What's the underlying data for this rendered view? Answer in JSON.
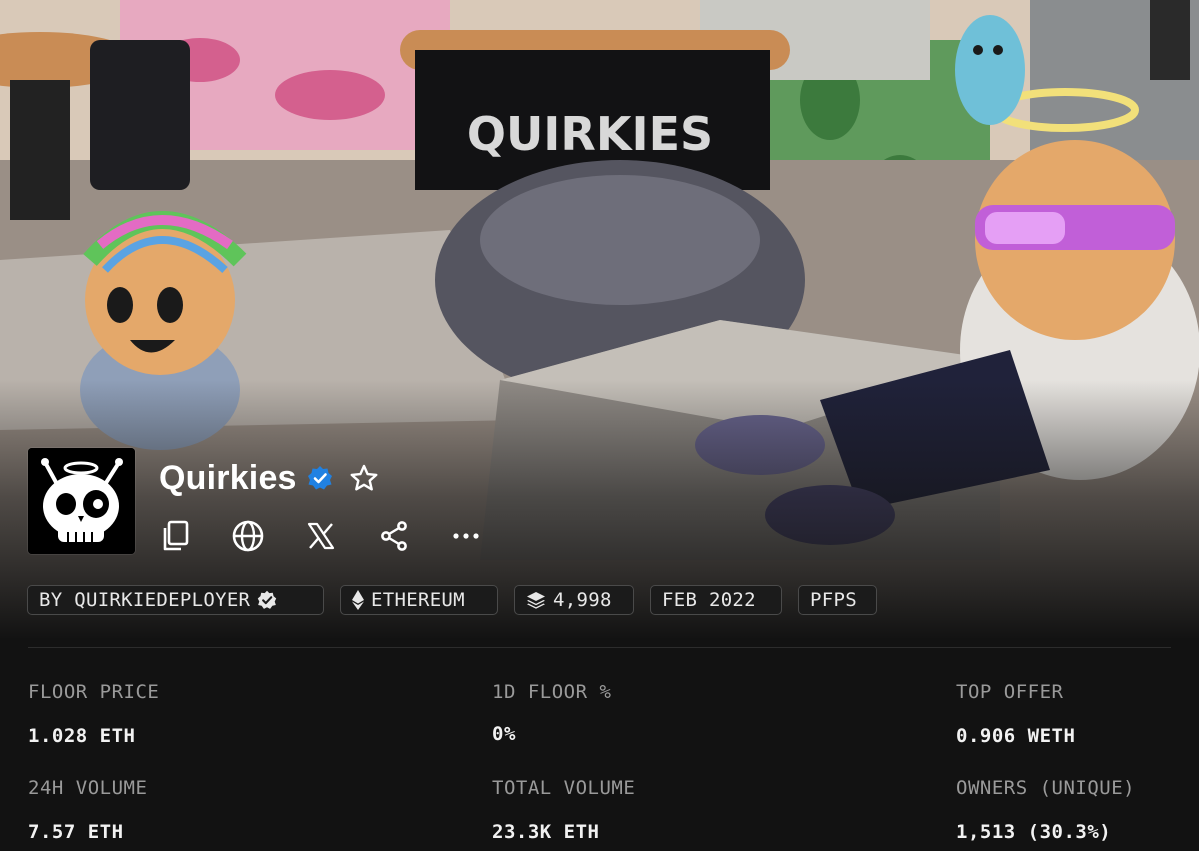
{
  "collection": {
    "title": "Quirkies",
    "verified_icon": "verified-badge-icon",
    "favorite_icon": "star-outline-icon"
  },
  "actions": [
    {
      "icon": "copy-icon"
    },
    {
      "icon": "globe-icon"
    },
    {
      "icon": "x-logo-icon"
    },
    {
      "icon": "share-icon"
    },
    {
      "icon": "more-icon"
    }
  ],
  "chips": {
    "creator": "BY QUIRKIEDEPLOYER",
    "chain": "ETHEREUM",
    "items": "4,998",
    "created": "FEB 2022",
    "category": "PFPS"
  },
  "stats": {
    "floor_price_label": "FLOOR PRICE",
    "floor_price_value": "1.028 ETH",
    "floor_change_label": "1D FLOOR %",
    "floor_change_value": "0%",
    "top_offer_label": "TOP OFFER",
    "top_offer_value": "0.906 WETH",
    "volume_24h_label": "24H VOLUME",
    "volume_24h_value": "7.57 ETH",
    "total_volume_label": "TOTAL VOLUME",
    "total_volume_value": "23.3K ETH",
    "owners_label": "OWNERS (UNIQUE)",
    "owners_value": "1,513 (30.3%)"
  },
  "banner": {
    "sign_text": "QUIRKIES"
  },
  "colors": {
    "background": "#121212",
    "verified_blue": "#2081e2",
    "chip_border": "#4a4a4a",
    "label_gray": "#9a9a9a"
  }
}
